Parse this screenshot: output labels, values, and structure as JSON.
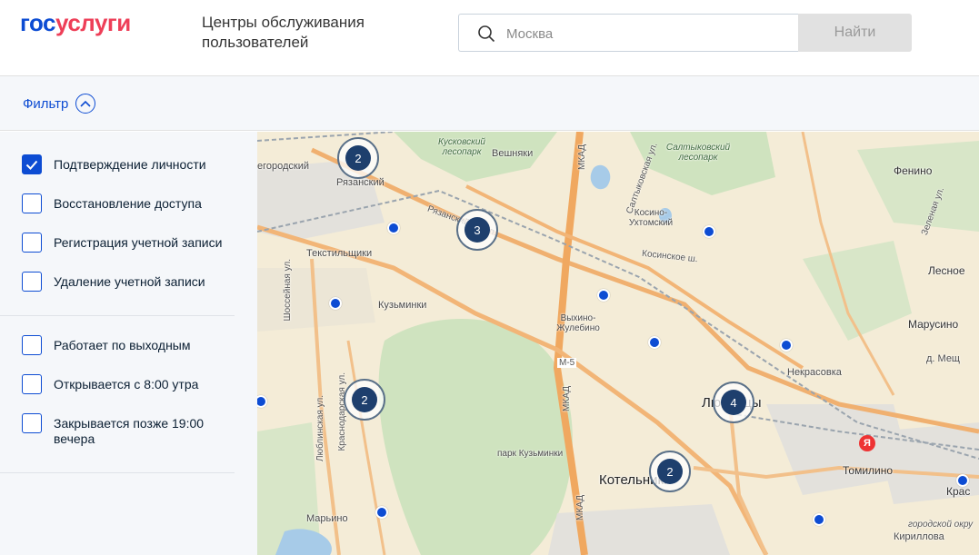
{
  "header": {
    "logo_part1": "гос",
    "logo_part2": "услуги",
    "title": "Центры обслуживания пользователей",
    "search_placeholder": "Москва",
    "search_icon": "search-icon",
    "find_button": "Найти"
  },
  "filter": {
    "label": "Фильтр",
    "toggle_icon": "chevron-up-icon",
    "options": [
      {
        "label": "Подтверждение личности",
        "checked": true
      },
      {
        "label": "Восстановление доступа",
        "checked": false
      },
      {
        "label": "Регистрация учетной записи",
        "checked": false
      },
      {
        "label": "Удаление учетной записи",
        "checked": false
      }
    ],
    "schedule_options": [
      {
        "label": "Работает по выходным",
        "checked": false
      },
      {
        "label": "Открывается с 8:00 утра",
        "checked": false
      },
      {
        "label": "Закрывается позже 19:00 вечера",
        "checked": false
      }
    ]
  },
  "map": {
    "labels": {
      "l0": "егородский",
      "l1": "Рязанский",
      "l2": "Кусковский лесопарк",
      "l3": "Вешняки",
      "l4": "МКАД",
      "l5": "Салтыковский лесопарк",
      "l6": "Фенино",
      "l7": "Рязанский просп.",
      "l8": "Косино-Ухтомский",
      "l9": "Текстильщики",
      "l10": "Косинское ш.",
      "l11": "Лесное",
      "l12": "Кузьминки",
      "l13": "Марусино",
      "l14": "Выхино-Жулебино",
      "l15": "д. Мещ",
      "l16": "М-5",
      "l17": "Некрасовка",
      "l18": "Люберцы",
      "l19": "МКАД",
      "l20": "Шоссейная ул.",
      "l21": "Люблинская ул.",
      "l22": "Краснодарская ул.",
      "l23": "парк Кузьминки",
      "l24": "Котельники",
      "l25": "Томилино",
      "l26": "Крас",
      "l27": "Марьино",
      "l28": "МКАД",
      "l29": "городской окру",
      "l30": "Кириллова",
      "l31": "Салтыковская ул.",
      "l32": "Зеленая ул."
    },
    "clusters": [
      "2",
      "3",
      "2",
      "4",
      "2"
    ],
    "yandex": "Я"
  }
}
